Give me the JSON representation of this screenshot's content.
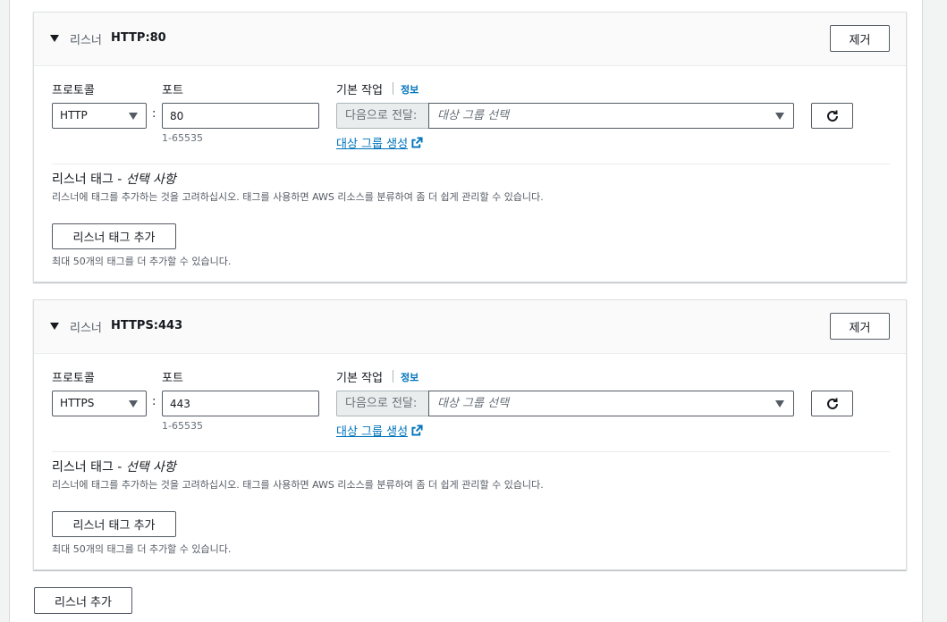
{
  "listeners": [
    {
      "prefix": "리스너",
      "name": "HTTP:80",
      "remove_label": "제거",
      "protocol_label": "프로토콜",
      "protocol_value": "HTTP",
      "port_label": "포트",
      "port_value": "80",
      "port_hint": "1-65535",
      "action_label": "기본 작업",
      "info_label": "정보",
      "forward_prefix": "다음으로 전달:",
      "target_group_placeholder": "대상 그룹 선택",
      "create_target_group_label": "대상 그룹 생성",
      "tags_title": "리스너 태그 - ",
      "tags_title_optional": "선택 사항",
      "tags_description": "리스너에 태그를 추가하는 것을 고려하십시오. 태그를 사용하면 AWS 리소스를 분류하여 좀 더 쉽게 관리할 수 있습니다.",
      "add_tag_label": "리스너 태그 추가",
      "tags_limit": "최대 50개의 태그를 더 추가할 수 있습니다."
    },
    {
      "prefix": "리스너",
      "name": "HTTPS:443",
      "remove_label": "제거",
      "protocol_label": "프로토콜",
      "protocol_value": "HTTPS",
      "port_label": "포트",
      "port_value": "443",
      "port_hint": "1-65535",
      "action_label": "기본 작업",
      "info_label": "정보",
      "forward_prefix": "다음으로 전달:",
      "target_group_placeholder": "대상 그룹 선택",
      "create_target_group_label": "대상 그룹 생성",
      "tags_title": "리스너 태그 - ",
      "tags_title_optional": "선택 사항",
      "tags_description": "리스너에 태그를 추가하는 것을 고려하십시오. 태그를 사용하면 AWS 리소스를 분류하여 좀 더 쉽게 관리할 수 있습니다.",
      "add_tag_label": "리스너 태그 추가",
      "tags_limit": "최대 50개의 태그를 더 추가할 수 있습니다."
    }
  ],
  "add_listener_label": "리스너 추가",
  "colors": {
    "link": "#0073bb",
    "border": "#545b64",
    "text": "#16191f"
  },
  "icons": {
    "collapse": "caret-down-icon",
    "refresh": "refresh-icon",
    "external": "external-link-icon"
  }
}
